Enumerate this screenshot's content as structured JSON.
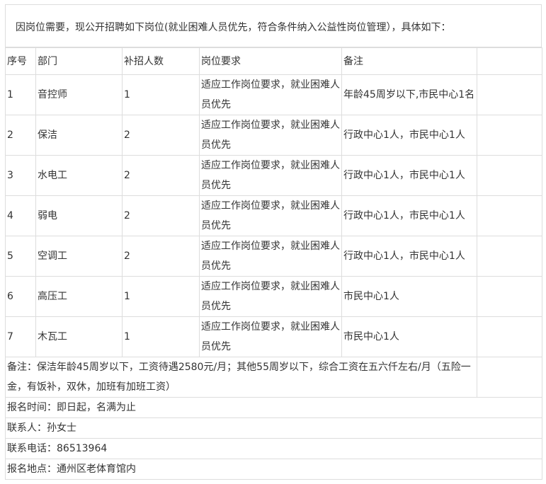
{
  "intro": "因岗位需要，现公开招聘如下岗位(就业困难人员优先，符合条件纳入公益性岗位管理），具体如下：",
  "table": {
    "headers": [
      "序号",
      "部门",
      "补招人数",
      "岗位要求",
      "备注"
    ],
    "rows": [
      {
        "no": "1",
        "dept": "音控师",
        "count": "1",
        "req": "适应工作岗位要求，就业困难人员优先",
        "remark": "年龄45周岁以下,市民中心1名"
      },
      {
        "no": "2",
        "dept": "保洁",
        "count": "2",
        "req": "适应工作岗位要求，就业困难人员优先",
        "remark": "行政中心1人，市民中心1人"
      },
      {
        "no": "3",
        "dept": "水电工",
        "count": "2",
        "req": "适应工作岗位要求，就业困难人员优先",
        "remark": "行政中心1人，市民中心1人"
      },
      {
        "no": "4",
        "dept": "弱电",
        "count": "2",
        "req": "适应工作岗位要求，就业困难人员优先",
        "remark": "行政中心1人，市民中心1人"
      },
      {
        "no": "5",
        "dept": "空调工",
        "count": "2",
        "req": "适应工作岗位要求，就业困难人员优先",
        "remark": "行政中心1人，市民中心1人"
      },
      {
        "no": "6",
        "dept": "高压工",
        "count": "1",
        "req": "适应工作岗位要求，就业困难人员优先",
        "remark": "市民中心1人"
      },
      {
        "no": "7",
        "dept": "木瓦工",
        "count": "1",
        "req": "适应工作岗位要求，就业困难人员优先",
        "remark": "市民中心1人"
      }
    ],
    "note": "备注：保洁年龄45周岁以下，工资待遇2580元/月；其他55周岁以下，综合工资在五六仟左右/月（五险一金，有饭补，双休，加班有加班工资）",
    "info": [
      "报名时间：即日起，名满为止",
      "联系人：孙女士",
      "联系电话：86513964",
      "报名地点：通州区老体育馆内"
    ]
  }
}
